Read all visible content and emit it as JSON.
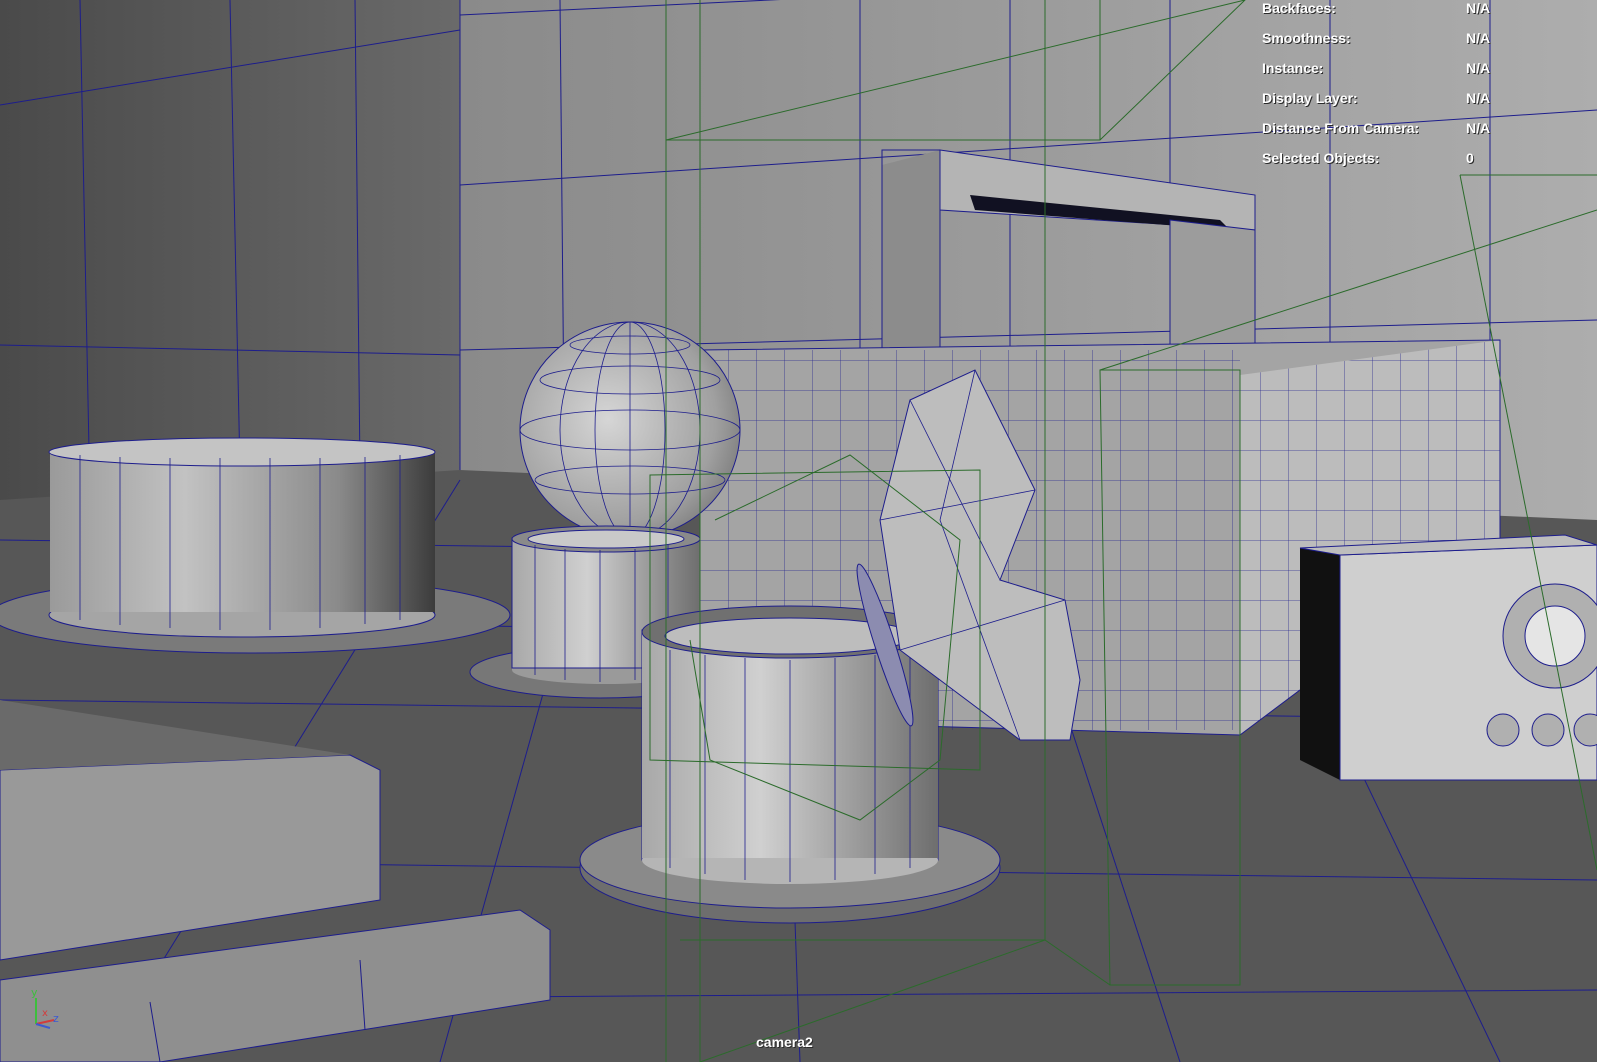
{
  "viewport": {
    "camera_name": "camera2",
    "background_color": "#4d4d4d",
    "wire_color": "#1d1d8c",
    "camera_frustum_color": "#2b6b2b"
  },
  "hud": {
    "rows": [
      {
        "label": "Backfaces:",
        "value": "N/A"
      },
      {
        "label": "Smoothness:",
        "value": "N/A"
      },
      {
        "label": "Instance:",
        "value": "N/A"
      },
      {
        "label": "Display Layer:",
        "value": "N/A"
      },
      {
        "label": "Distance From Camera:",
        "value": "N/A"
      },
      {
        "label": "Selected Objects:",
        "value": "0"
      }
    ]
  },
  "axis_gizmo": {
    "x": "x",
    "y": "y",
    "z": "z"
  },
  "scene_objects": [
    "room-walls",
    "floor-plane",
    "cylinder-left-large",
    "sphere-back",
    "cylinder-small-center",
    "cylinder-front-center",
    "arch-back",
    "box-right-large",
    "speaker-box-right",
    "step-blocks-left",
    "mesh-panel-tilted",
    "camera-frustum"
  ]
}
